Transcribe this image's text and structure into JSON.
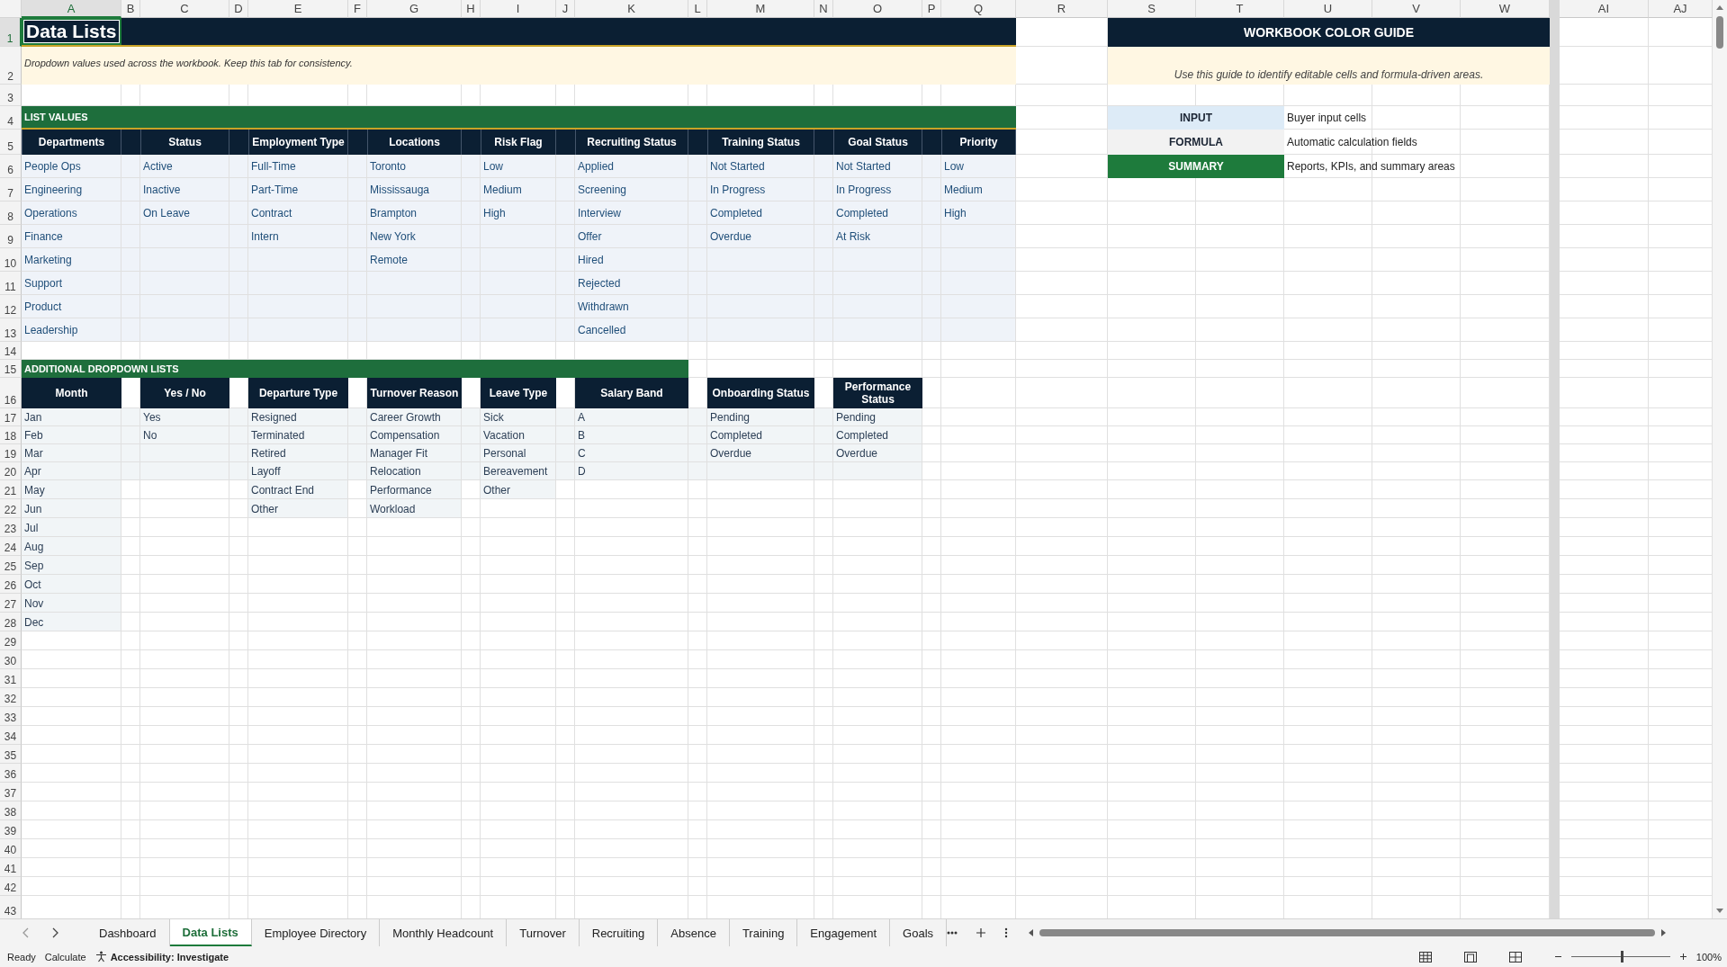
{
  "columns": [
    {
      "label": "A",
      "selected": true
    },
    {
      "label": "B",
      "selected": false
    },
    {
      "label": "C",
      "selected": false
    },
    {
      "label": "D",
      "selected": false
    },
    {
      "label": "E",
      "selected": false
    },
    {
      "label": "F",
      "selected": false
    },
    {
      "label": "G",
      "selected": false
    },
    {
      "label": "H",
      "selected": false
    },
    {
      "label": "I",
      "selected": false
    },
    {
      "label": "J",
      "selected": false
    },
    {
      "label": "K",
      "selected": false
    },
    {
      "label": "L",
      "selected": false
    },
    {
      "label": "M",
      "selected": false
    },
    {
      "label": "N",
      "selected": false
    },
    {
      "label": "O",
      "selected": false
    },
    {
      "label": "P",
      "selected": false
    },
    {
      "label": "Q",
      "selected": false
    },
    {
      "label": "R",
      "selected": false
    },
    {
      "label": "S",
      "selected": false
    },
    {
      "label": "T",
      "selected": false
    },
    {
      "label": "U",
      "selected": false
    },
    {
      "label": "V",
      "selected": false
    },
    {
      "label": "W",
      "selected": false
    },
    {
      "label": "AI",
      "selected": false
    },
    {
      "label": "AJ",
      "selected": false
    }
  ],
  "rows": [
    {
      "label": "1",
      "selected": true
    },
    {
      "label": "2",
      "selected": false
    },
    {
      "label": "3",
      "selected": false
    },
    {
      "label": "4",
      "selected": false
    },
    {
      "label": "5",
      "selected": false
    },
    {
      "label": "6",
      "selected": false
    },
    {
      "label": "7",
      "selected": false
    },
    {
      "label": "8",
      "selected": false
    },
    {
      "label": "9",
      "selected": false
    },
    {
      "label": "10",
      "selected": false
    },
    {
      "label": "11",
      "selected": false
    },
    {
      "label": "12",
      "selected": false
    },
    {
      "label": "13",
      "selected": false
    },
    {
      "label": "14",
      "selected": false
    },
    {
      "label": "15",
      "selected": false
    },
    {
      "label": "16",
      "selected": false
    },
    {
      "label": "17",
      "selected": false
    },
    {
      "label": "18",
      "selected": false
    },
    {
      "label": "19",
      "selected": false
    },
    {
      "label": "20",
      "selected": false
    },
    {
      "label": "21",
      "selected": false
    },
    {
      "label": "22",
      "selected": false
    },
    {
      "label": "23",
      "selected": false
    },
    {
      "label": "24",
      "selected": false
    },
    {
      "label": "25",
      "selected": false
    },
    {
      "label": "26",
      "selected": false
    },
    {
      "label": "27",
      "selected": false
    },
    {
      "label": "28",
      "selected": false
    },
    {
      "label": "29",
      "selected": false
    },
    {
      "label": "30",
      "selected": false
    },
    {
      "label": "31",
      "selected": false
    },
    {
      "label": "32",
      "selected": false
    },
    {
      "label": "33",
      "selected": false
    },
    {
      "label": "34",
      "selected": false
    },
    {
      "label": "35",
      "selected": false
    },
    {
      "label": "36",
      "selected": false
    },
    {
      "label": "37",
      "selected": false
    },
    {
      "label": "38",
      "selected": false
    },
    {
      "label": "39",
      "selected": false
    },
    {
      "label": "40",
      "selected": false
    },
    {
      "label": "41",
      "selected": false
    },
    {
      "label": "42",
      "selected": false
    },
    {
      "label": "43",
      "selected": false
    }
  ],
  "title": "Data Lists",
  "subtitle": "Dropdown values used across the workbook. Keep this tab for consistency.",
  "list_values": {
    "label": "LIST VALUES",
    "lists": [
      {
        "header": "Departments",
        "values": [
          "People Ops",
          "Engineering",
          "Operations",
          "Finance",
          "Marketing",
          "Support",
          "Product",
          "Leadership"
        ]
      },
      {
        "header": "Status",
        "values": [
          "Active",
          "Inactive",
          "On Leave"
        ]
      },
      {
        "header": "Employment Type",
        "values": [
          "Full-Time",
          "Part-Time",
          "Contract",
          "Intern"
        ]
      },
      {
        "header": "Locations",
        "values": [
          "Toronto",
          "Mississauga",
          "Brampton",
          "New York",
          "Remote"
        ]
      },
      {
        "header": "Risk Flag",
        "values": [
          "Low",
          "Medium",
          "High"
        ]
      },
      {
        "header": "Recruiting Status",
        "values": [
          "Applied",
          "Screening",
          "Interview",
          "Offer",
          "Hired",
          "Rejected",
          "Withdrawn",
          "Cancelled"
        ]
      },
      {
        "header": "Training Status",
        "values": [
          "Not Started",
          "In Progress",
          "Completed",
          "Overdue"
        ]
      },
      {
        "header": "Goal Status",
        "values": [
          "Not Started",
          "In Progress",
          "Completed",
          "At Risk"
        ]
      },
      {
        "header": "Priority",
        "values": [
          "Low",
          "Medium",
          "High"
        ]
      }
    ]
  },
  "additional_lists": {
    "label": "ADDITIONAL DROPDOWN LISTS",
    "lists": [
      {
        "header": "Month",
        "values": [
          "Jan",
          "Feb",
          "Mar",
          "Apr",
          "May",
          "Jun",
          "Jul",
          "Aug",
          "Sep",
          "Oct",
          "Nov",
          "Dec"
        ]
      },
      {
        "header": "Yes / No",
        "values": [
          "Yes",
          "No"
        ]
      },
      {
        "header": "Departure Type",
        "values": [
          "Resigned",
          "Terminated",
          "Retired",
          "Layoff",
          "Contract End",
          "Other"
        ]
      },
      {
        "header": "Turnover Reason",
        "values": [
          "Career Growth",
          "Compensation",
          "Manager Fit",
          "Relocation",
          "Performance",
          "Workload"
        ]
      },
      {
        "header": "Leave Type",
        "values": [
          "Sick",
          "Vacation",
          "Personal",
          "Bereavement",
          "Other"
        ]
      },
      {
        "header": "Salary Band",
        "values": [
          "A",
          "B",
          "C",
          "D"
        ]
      },
      {
        "header": "Onboarding Status",
        "values": [
          "Pending",
          "Completed",
          "Overdue"
        ]
      },
      {
        "header": "Performance Status",
        "values": [
          "Pending",
          "Completed",
          "Overdue"
        ]
      }
    ]
  },
  "color_guide": {
    "title": "WORKBOOK COLOR GUIDE",
    "note": "Use this guide to identify editable cells and formula-driven areas.",
    "items": [
      {
        "label": "INPUT",
        "color": "#ddebf7",
        "description": "Buyer input cells"
      },
      {
        "label": "FORMULA",
        "color": "#f2f2f2",
        "description": "Automatic calculation fields"
      },
      {
        "label": "SUMMARY",
        "color": "#1e7b3c",
        "description": "Reports, KPIs, and summary areas"
      }
    ]
  },
  "sheet_tabs": [
    {
      "label": "Dashboard",
      "selected": false
    },
    {
      "label": "Data Lists",
      "selected": true
    },
    {
      "label": "Employee Directory",
      "selected": false
    },
    {
      "label": "Monthly Headcount",
      "selected": false
    },
    {
      "label": "Turnover",
      "selected": false
    },
    {
      "label": "Recruiting",
      "selected": false
    },
    {
      "label": "Absence",
      "selected": false
    },
    {
      "label": "Training",
      "selected": false
    },
    {
      "label": "Engagement",
      "selected": false
    },
    {
      "label": "Goals",
      "selected": false
    }
  ],
  "status_bar": {
    "mode": "Ready",
    "calculate": "Calculate",
    "accessibility": "Accessibility: Investigate",
    "zoom": {
      "level": 0.5,
      "reading": "100%"
    }
  }
}
